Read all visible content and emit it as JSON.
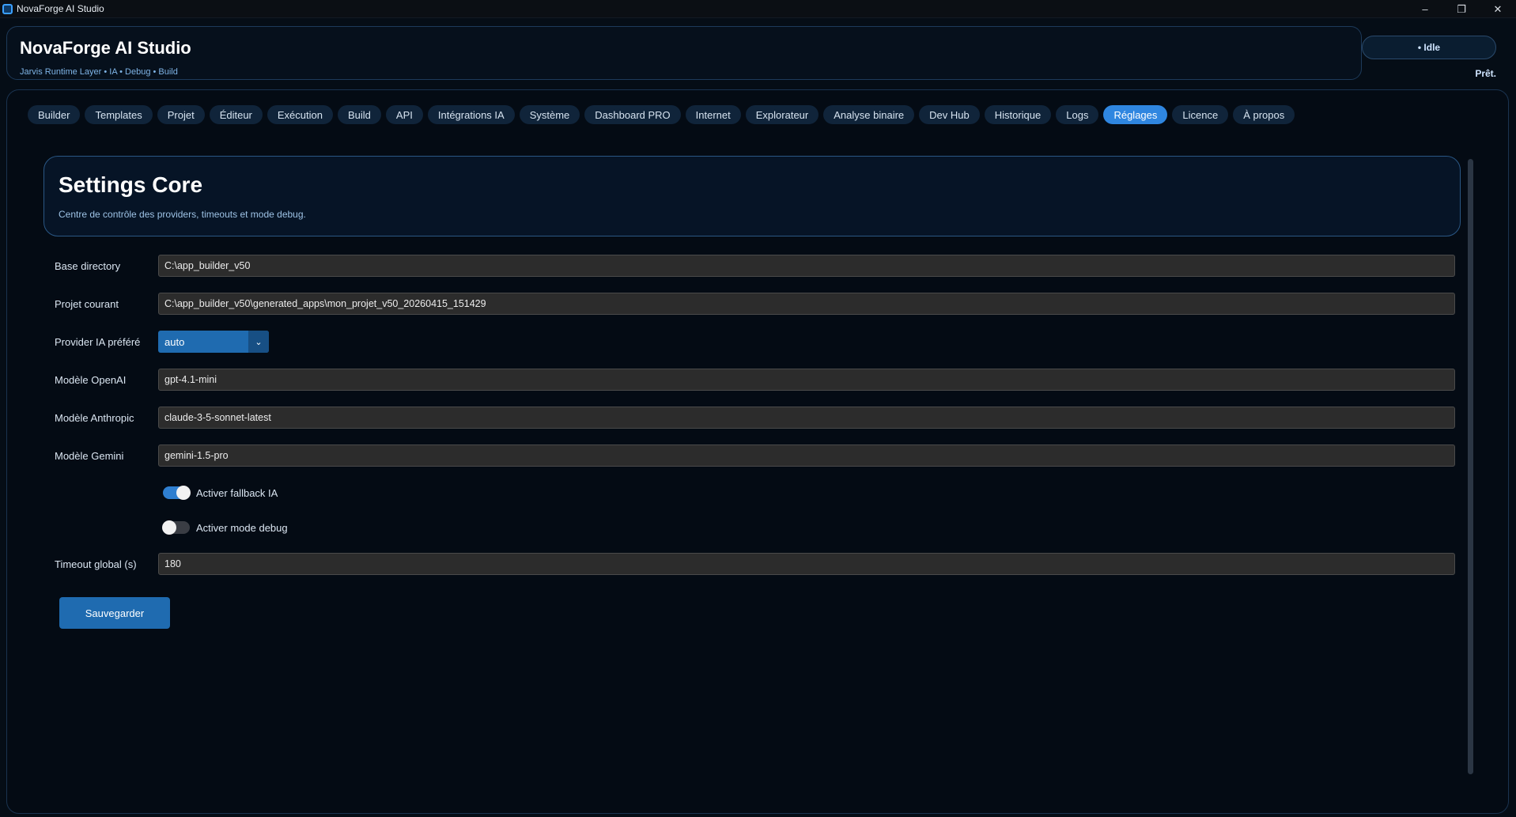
{
  "window": {
    "title": "NovaForge AI Studio",
    "controls": {
      "minimize": "–",
      "restore": "❐",
      "close": "✕"
    }
  },
  "header": {
    "title": "NovaForge AI Studio",
    "subtitle": "Jarvis Runtime Layer • IA • Debug • Build",
    "status_pill": "• Idle",
    "status_text": "Prêt."
  },
  "tabs": [
    {
      "label": "Builder"
    },
    {
      "label": "Templates"
    },
    {
      "label": "Projet"
    },
    {
      "label": "Éditeur"
    },
    {
      "label": "Exécution"
    },
    {
      "label": "Build"
    },
    {
      "label": "API"
    },
    {
      "label": "Intégrations IA"
    },
    {
      "label": "Système"
    },
    {
      "label": "Dashboard PRO"
    },
    {
      "label": "Internet"
    },
    {
      "label": "Explorateur"
    },
    {
      "label": "Analyse binaire"
    },
    {
      "label": "Dev Hub"
    },
    {
      "label": "Historique"
    },
    {
      "label": "Logs"
    },
    {
      "label": "Réglages"
    },
    {
      "label": "Licence"
    },
    {
      "label": "À propos"
    }
  ],
  "active_tab": "Réglages",
  "settings": {
    "title": "Settings Core",
    "subtitle": "Centre de contrôle des providers, timeouts et mode debug.",
    "base_directory": {
      "label": "Base directory",
      "value": "C:\\app_builder_v50"
    },
    "current_project": {
      "label": "Projet courant",
      "value": "C:\\app_builder_v50\\generated_apps\\mon_projet_v50_20260415_151429"
    },
    "provider": {
      "label": "Provider IA préféré",
      "value": "auto"
    },
    "openai_model": {
      "label": "Modèle OpenAI",
      "value": "gpt-4.1-mini"
    },
    "anthropic_model": {
      "label": "Modèle Anthropic",
      "value": "claude-3-5-sonnet-latest"
    },
    "gemini_model": {
      "label": "Modèle Gemini",
      "value": "gemini-1.5-pro"
    },
    "fallback_toggle": {
      "label": "Activer fallback IA",
      "on": true
    },
    "debug_toggle": {
      "label": "Activer mode debug",
      "on": false
    },
    "timeout": {
      "label": "Timeout global (s)",
      "value": "180"
    },
    "save_label": "Sauvegarder"
  },
  "colors": {
    "accent": "#2f86e0",
    "background": "#050d16",
    "button": "#1f6bb0"
  }
}
